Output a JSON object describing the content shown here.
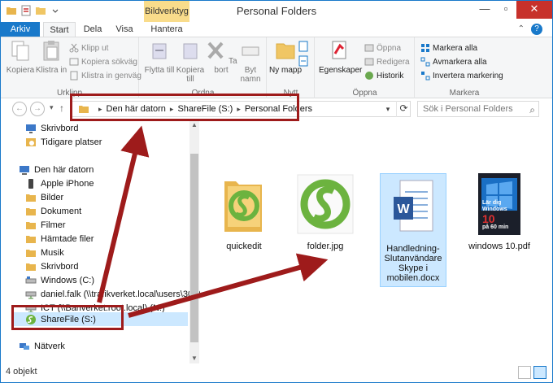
{
  "window": {
    "title": "Personal Folders",
    "context_tab": "Bildverktyg"
  },
  "tabs": [
    {
      "label": "Arkiv"
    },
    {
      "label": "Start"
    },
    {
      "label": "Dela"
    },
    {
      "label": "Visa"
    },
    {
      "label": "Hantera"
    }
  ],
  "ribbon": {
    "clipboard": {
      "label": "Urklipp",
      "copy": "Kopiera",
      "paste": "Klistra in",
      "cut": "Klipp ut",
      "copy_path": "Kopiera sökväg",
      "paste_shortcut": "Klistra in genväg"
    },
    "organize": {
      "label": "Ordna",
      "move_to": "Flytta till",
      "copy_to": "Kopiera till",
      "delete": "Ta bort",
      "rename": "Byt namn"
    },
    "new": {
      "label": "Nytt",
      "new_folder": "Ny mapp"
    },
    "open": {
      "label": "Öppna",
      "properties": "Egenskaper",
      "open": "Öppna",
      "edit": "Redigera",
      "history": "Historik"
    },
    "select": {
      "label": "Markera",
      "select_all": "Markera alla",
      "select_none": "Avmarkera alla",
      "invert": "Invertera markering"
    }
  },
  "address": {
    "crumbs": [
      "Den här datorn",
      "ShareFile (S:)",
      "Personal Folders"
    ],
    "search_placeholder": "Sök i Personal Folders"
  },
  "nav": {
    "items": [
      {
        "label": "Skrivbord",
        "icon": "desktop-icon"
      },
      {
        "label": "Tidigare platser",
        "icon": "recent-places-icon"
      },
      {
        "label": "Den här datorn",
        "icon": "computer-icon"
      },
      {
        "label": "Apple iPhone",
        "icon": "phone-icon"
      },
      {
        "label": "Bilder",
        "icon": "pictures-folder-icon"
      },
      {
        "label": "Dokument",
        "icon": "documents-folder-icon"
      },
      {
        "label": "Filmer",
        "icon": "videos-folder-icon"
      },
      {
        "label": "Hämtade filer",
        "icon": "downloads-folder-icon"
      },
      {
        "label": "Musik",
        "icon": "music-folder-icon"
      },
      {
        "label": "Skrivbord",
        "icon": "desktop-folder-icon"
      },
      {
        "label": "Windows (C:)",
        "icon": "drive-icon"
      },
      {
        "label": "daniel.falk (\\\\trafikverket.local\\users\\30) (M",
        "icon": "network-drive-icon"
      },
      {
        "label": "ICT (\\\\Banverket.root.local) (N:)",
        "icon": "network-drive-icon"
      },
      {
        "label": "ShareFile (S:)",
        "icon": "sharefile-icon"
      },
      {
        "label": "Nätverk",
        "icon": "network-icon"
      }
    ]
  },
  "files": [
    {
      "name": "quickedit",
      "type": "folder"
    },
    {
      "name": "folder.jpg",
      "type": "image"
    },
    {
      "name": "Handledning-Slutanvändare Skype i mobilen.docx",
      "type": "word"
    },
    {
      "name": "windows 10.pdf",
      "type": "pdf"
    }
  ],
  "pdf_cover": {
    "line1": "Lär dig",
    "line2": "Windows",
    "line3": "10",
    "line4": "på 60 min"
  },
  "status": {
    "count": "4 objekt"
  },
  "colors": {
    "accent": "#1979ca",
    "annotation": "#9e1b1b",
    "selection": "#cce8ff",
    "context_tab": "#f9dc8b"
  }
}
